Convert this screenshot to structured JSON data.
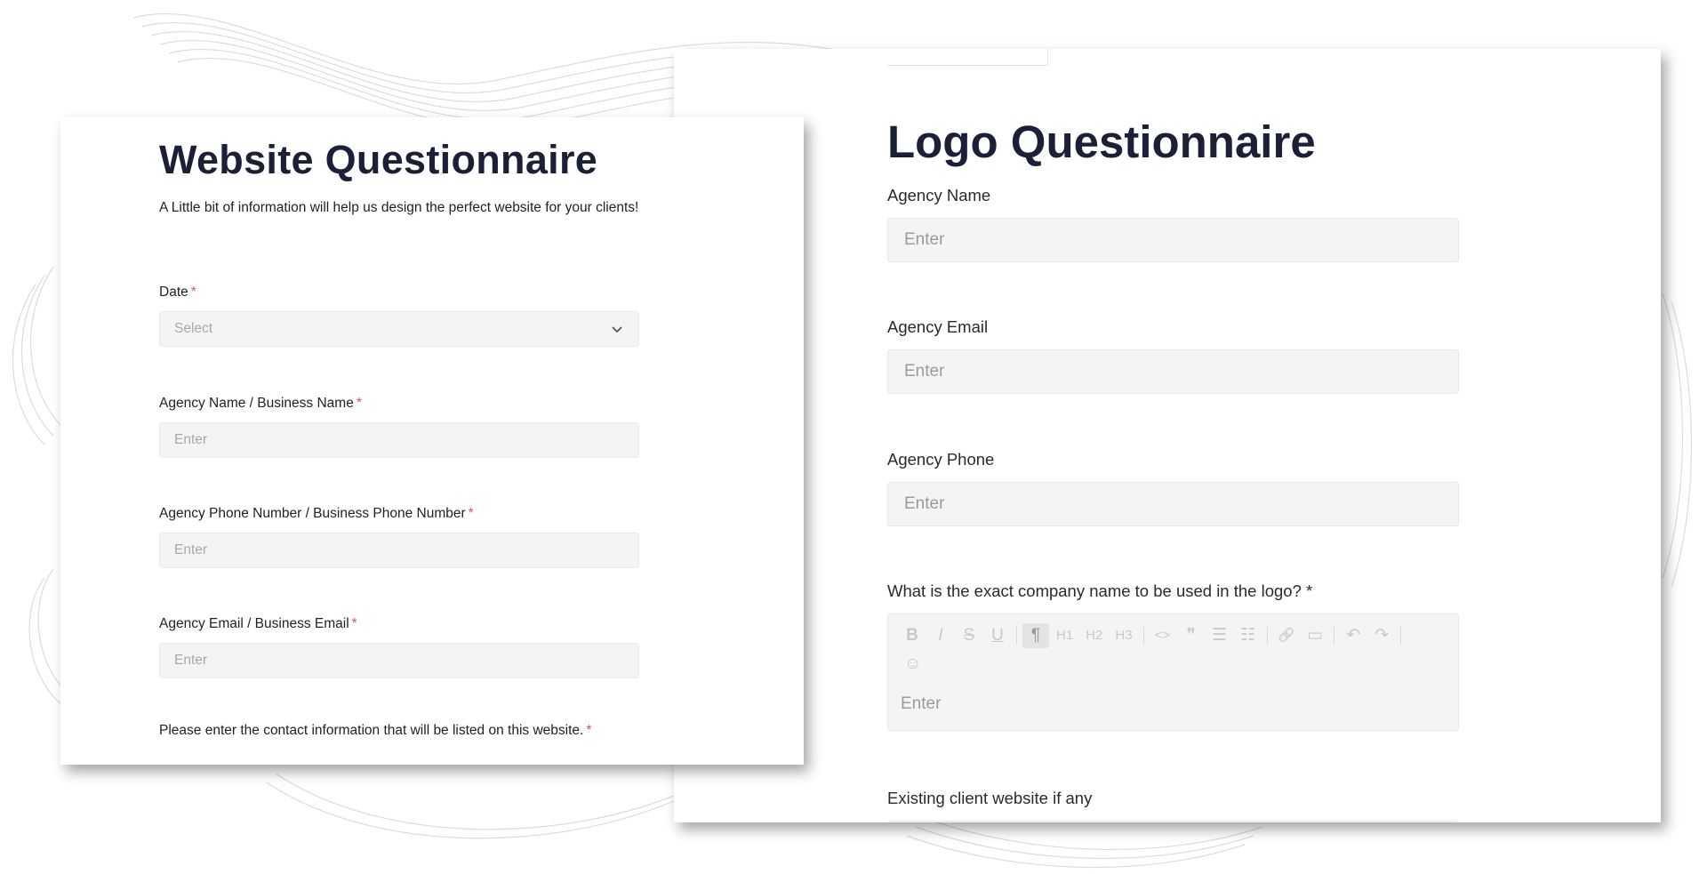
{
  "left_form": {
    "title": "Website Questionnaire",
    "description": "A Little bit of information will help us design the perfect website for your clients!",
    "fields": [
      {
        "label": "Date",
        "required": "*",
        "placeholder": "Select",
        "type": "select"
      },
      {
        "label": "Agency Name / Business Name",
        "required": "*",
        "placeholder": "Enter",
        "type": "text"
      },
      {
        "label": "Agency Phone Number / Business Phone Number",
        "required": "*",
        "placeholder": "Enter",
        "type": "text"
      },
      {
        "label": "Agency Email / Business Email",
        "required": "*",
        "placeholder": "Enter",
        "type": "text"
      },
      {
        "label": "Please enter the contact information that will be listed on this website.",
        "required": "*"
      }
    ]
  },
  "right_form": {
    "title": "Logo Questionnaire",
    "fields": [
      {
        "label": "Agency Name",
        "placeholder": "Enter"
      },
      {
        "label": "Agency Email",
        "placeholder": "Enter"
      },
      {
        "label": "Agency Phone",
        "placeholder": "Enter"
      },
      {
        "label": "What is the exact company name to be used in the logo? *",
        "placeholder": "Enter"
      },
      {
        "label": "Existing client website if any"
      }
    ],
    "toolbar": {
      "bold": "B",
      "italic": "I",
      "strike": "S",
      "underline": "U",
      "paragraph": "¶",
      "h1": "H1",
      "h2": "H2",
      "h3": "H3",
      "code": "<>",
      "quote": "❞",
      "bullet_list": "☰",
      "ordered_list": "☷",
      "link": "🔗",
      "embed": "▭",
      "undo": "↶",
      "redo": "↷",
      "emoji": "☺"
    }
  },
  "colors": {
    "required": "#e45151",
    "title": "#1b2038",
    "input_bg": "#f4f4f4"
  }
}
